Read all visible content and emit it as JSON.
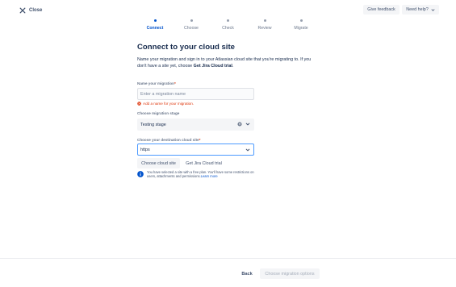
{
  "topbar": {
    "close_label": "Close",
    "feedback_label": "Give feedback",
    "help_label": "Need help?"
  },
  "stepper": {
    "steps": [
      {
        "label": "Connect",
        "state": "active"
      },
      {
        "label": "Choose",
        "state": "pending"
      },
      {
        "label": "Check",
        "state": "pending"
      },
      {
        "label": "Review",
        "state": "pending"
      },
      {
        "label": "Migrate",
        "state": "pending"
      }
    ]
  },
  "main": {
    "title": "Connect to your cloud site",
    "intro_text": "Name your migration and sign in to your Atlassian cloud site that you're migrating to. If you don't have a site yet, choose",
    "intro_bold": "Get Jira Cloud trial",
    "intro_end": "."
  },
  "form": {
    "name": {
      "label": "Name your migration",
      "required_mark": "*",
      "placeholder": "Enter a migration name",
      "error": "Add a name for your migration."
    },
    "stage": {
      "label": "Choose migration stage",
      "value": "Testing stage"
    },
    "destination": {
      "label": "Choose your destination cloud site",
      "required_mark": "*",
      "value": "https"
    },
    "choose_site_label": "Choose cloud site",
    "trial_label": "Get Jira Cloud trial",
    "info_text": "You have selected a site with a free plan. You'll have some restrictions on users, attachments and permissions.",
    "info_link": "Learn more"
  },
  "footer": {
    "back_label": "Back",
    "next_label": "Choose migration options"
  },
  "colors": {
    "accent": "#0052cc",
    "error": "#de350b",
    "focus_border": "#4c9aff",
    "text": "#172b4d",
    "subtle_text": "#6b778c"
  },
  "icons": [
    "close-icon",
    "chevron-down-icon",
    "error-icon",
    "clear-icon",
    "info-icon"
  ]
}
